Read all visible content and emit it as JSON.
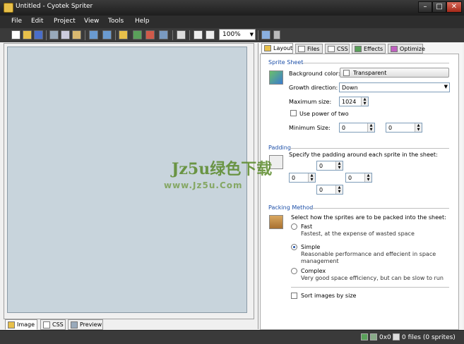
{
  "window": {
    "title": "Untitled - Cyotek Spriter"
  },
  "menu": [
    "File",
    "Edit",
    "Project",
    "View",
    "Tools",
    "Help"
  ],
  "toolbar": {
    "zoom": "100%"
  },
  "left_tabs": [
    "Image",
    "CSS",
    "Preview"
  ],
  "right_tabs": [
    "Layout",
    "Files",
    "CSS",
    "Effects",
    "Optimize"
  ],
  "sprite_sheet": {
    "title": "Sprite Sheet",
    "background_label": "Background color:",
    "background_value": "Transparent",
    "growth_label": "Growth direction:",
    "growth_value": "Down",
    "max_size_label": "Maximum size:",
    "max_size_value": "1024",
    "power_of_two": "Use power of two",
    "min_size_label": "Minimum Size:",
    "min_w": "0",
    "min_h": "0"
  },
  "padding": {
    "title": "Padding",
    "description": "Specify the padding around each sprite in the sheet:",
    "top": "0",
    "left": "0",
    "right": "0",
    "bottom": "0"
  },
  "packing": {
    "title": "Packing Method",
    "description": "Select how the sprites are to be packed into the sheet:",
    "fast": "Fast",
    "fast_desc": "Fastest, at the expense of wasted space",
    "simple": "Simple",
    "simple_desc1": "Reasonable performance and effecient in space",
    "simple_desc2": "management",
    "complex": "Complex",
    "complex_desc": "Very good space efficiency, but can be slow to run",
    "sort": "Sort images by size"
  },
  "watermark": {
    "main": "Jz5u绿色下载",
    "sub": "www.Jz5u.Com"
  },
  "status": {
    "dimensions": "0x0",
    "files": "0 files (0 sprites)"
  }
}
